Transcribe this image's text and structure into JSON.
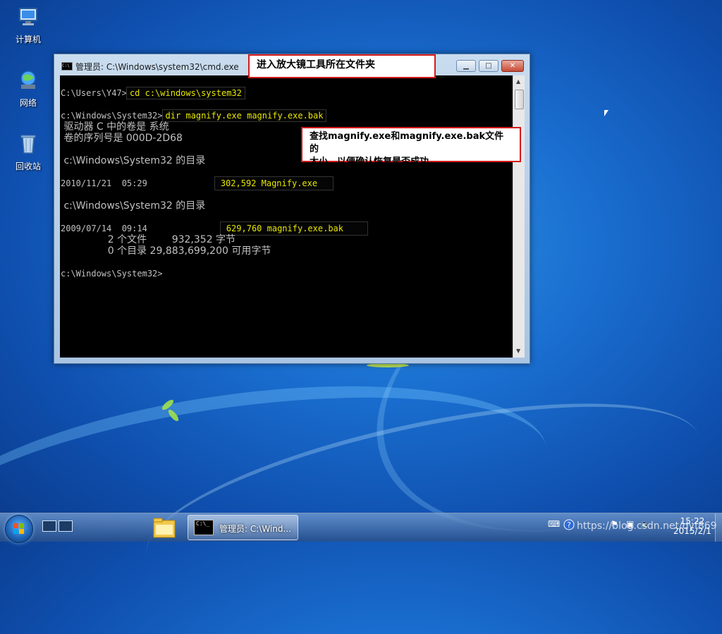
{
  "desktop": {
    "icons": [
      {
        "label": "计算机"
      },
      {
        "label": "网络"
      },
      {
        "label": "回收站"
      }
    ]
  },
  "cmd_window": {
    "title": "管理员: C:\\Windows\\system32\\cmd.exe",
    "buttons": {
      "minimize": "▁",
      "maximize": "□",
      "close": "✕"
    },
    "lines": [
      {
        "prompt": "C:\\Users\\Y47>",
        "cmd": "cd c:\\windows\\system32"
      },
      {
        "prompt": "c:\\Windows\\System32>",
        "cmd": "dir magnify.exe magnify.exe.bak"
      },
      {
        "text": " 驱动器 C 中的卷是 系统"
      },
      {
        "text": " 卷的序列号是 000D-2D68"
      },
      {
        "text": " c:\\Windows\\System32 的目录"
      },
      {
        "date": "2010/11/21  05:29",
        "entry": "302,592 Magnify.exe"
      },
      {
        "text": " c:\\Windows\\System32 的目录"
      },
      {
        "date": "2009/07/14  09:14",
        "entry": "629,760 magnify.exe.bak"
      },
      {
        "text": "               2 个文件        932,352 字节"
      },
      {
        "text": "               0 个目录 29,883,699,200 可用字节"
      },
      {
        "text": "c:\\Windows\\System32>"
      }
    ]
  },
  "callouts": {
    "top": "进入放大镜工具所在文件夹",
    "right_line1": "查找magnify.exe和magnify.exe.bak文件的",
    "right_line2": "大小，以便确认恢复是否成功"
  },
  "taskbar": {
    "active_task_label": "管理员: C:\\Wind...",
    "clock_time": "15:22",
    "clock_date": "2015/2/1",
    "watermark": "https://blog.csdn.net/dyf869"
  },
  "colors": {
    "console_bg": "#000000",
    "console_text": "#c0c0c0",
    "highlight_text": "#e6e600",
    "callout_border": "#d41a1a"
  }
}
